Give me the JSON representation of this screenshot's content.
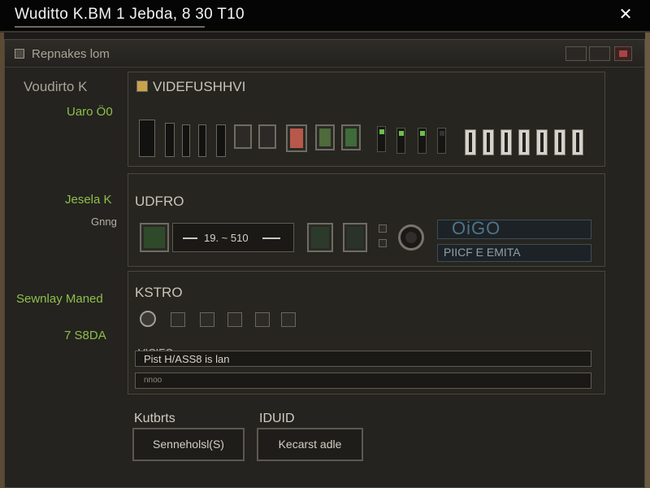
{
  "topbar": {
    "title": "Wuditto K.BM 1 Jebda, 8 30 T10"
  },
  "window": {
    "title": "Repnakes lom"
  },
  "sidebar": {
    "label1": "Voudirto K",
    "label2": "Uaro Ö0",
    "label3": "Jesela K",
    "label4": "Gnng",
    "label5": "Sewnlay Maned",
    "label6": "7 S8DA"
  },
  "panel1": {
    "title": "VIDEFUSHHVI"
  },
  "panel2": {
    "title": "UDFRO",
    "time_field": "19. ~ 510",
    "display_top": "OiGO",
    "display_bottom": "PIICF E EMITA"
  },
  "panel3": {
    "title": "KSTRO",
    "field_label": "VICIFO",
    "field_value": "Pist H/ASS8 is lan",
    "field2_value": "nnoo"
  },
  "buttons": {
    "left_caption": "Kutbrts",
    "left_label": "Senneholsl(S)",
    "right_caption": "IDUID",
    "right_label": "Kecarst adle"
  },
  "colors": {
    "accent_green": "#8fbf4a",
    "display_blue": "#4f7489"
  },
  "icons": {
    "close": "close-icon",
    "app": "app-icon"
  }
}
